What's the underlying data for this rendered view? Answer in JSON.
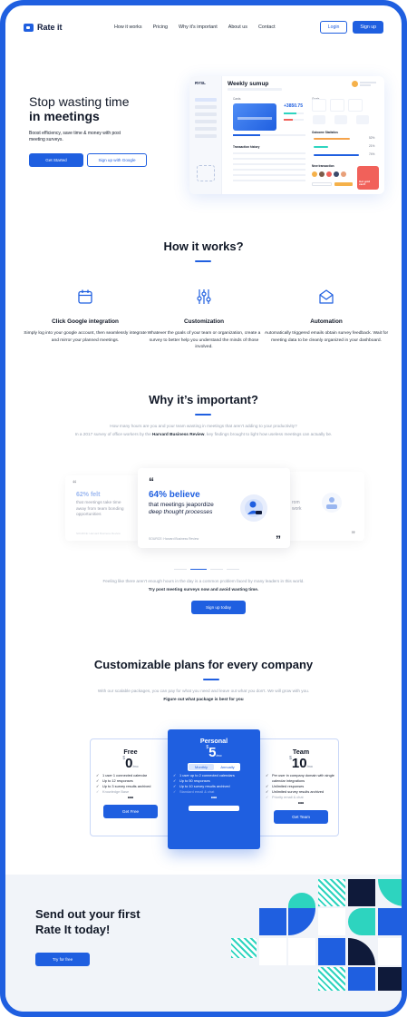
{
  "nav": {
    "logo": "Rate it",
    "links": [
      "How it works",
      "Pricing",
      "Why it's important",
      "About us",
      "Contact"
    ],
    "login": "Login",
    "signup": "Sign up"
  },
  "hero": {
    "title_line1": "Stop wasting time",
    "title_line2": "in meetings",
    "subtitle": "Boost efficiency, save time & money with post meeting surveys.",
    "primary_cta": "Get Started",
    "secondary_cta": "Sign up with Google",
    "dashboard": {
      "brand": "RYSL",
      "title": "Weekly sumup",
      "cards_label": "Cards",
      "amount": "+3850.75",
      "goals_label": "Goals",
      "history_label": "Transaction history",
      "outcome_label": "Outcome Statistics",
      "new_transaction_label": "New transaction",
      "pct1": "52%",
      "pct2": "21%",
      "pct3": "74%",
      "promo_card": "Get gold card!"
    }
  },
  "how": {
    "title": "How it works?",
    "features": [
      {
        "icon": "calendar-icon",
        "title": "Click Google integration",
        "desc": "Simply log into your google account, then seamlessly integrate and mirror your planned meetings."
      },
      {
        "icon": "sliders-icon",
        "title": "Customization",
        "desc": "Whatever the goals of your team or organization, create a survey to better help you understand the minds of those involved."
      },
      {
        "icon": "envelope-icon",
        "title": "Automation",
        "desc": "Automatically triggered emails obtain survey feedback. Wait for meeting data to be cleanly organized in your dashboard."
      }
    ]
  },
  "why": {
    "title": "Why it’s important?",
    "intro1": "How many hours are you and your team wasting in meetings that aren't adding to your productivity?",
    "intro2_pre": "In a 2017 survey of office workers by the ",
    "intro2_source": "Harvard Business Review",
    "intro2_post": ", key findings brought to light how useless meetings can actually be.",
    "left_card": {
      "pct": "62% felt",
      "text": "that meetings take time away from team bonding opportunities",
      "source": "SOURCE: Harvard Business Review"
    },
    "main_card": {
      "quote_open": "“",
      "pct": "64% believe",
      "line1": "that meetings jeapordize",
      "line2": "deep thought processes",
      "source": "SOURCE: Harvard Business Review",
      "quote_close": "”"
    },
    "right_card": {
      "text_a": "rom",
      "text_b": "work",
      "quote_close": "”"
    },
    "outro1": "Feeling like there aren't enough hours in the day is a common problem faced by many leaders in this world.",
    "outro2": "Try post meeting surveys now and avoid wasting time.",
    "cta": "Sign up today"
  },
  "pricing": {
    "title": "Customizable plans for every company",
    "intro1": "With our scalable packages, you can pay for what you need and leave out what you don't. We will grow with you.",
    "intro2": "Figure out what package is best for you",
    "plans": [
      {
        "name": "Free",
        "currency": "$",
        "price": "0",
        "unit": "/mo",
        "features": [
          "1 user 1 connected calendar",
          "Up to 12 responses",
          "Up to 3 survey results archived"
        ],
        "dim": "Knowledge Base",
        "more": "•••",
        "cta": "Get Free"
      },
      {
        "name": "Personal",
        "currency": "$",
        "price": "5",
        "unit": "/mo",
        "toggle": [
          "Monthly",
          "Annually"
        ],
        "features": [
          "1 user up to 2 connected calendars",
          "Up to 50 responses",
          "Up to 10 survey results archived"
        ],
        "dim": "Standard email & chat",
        "more": "•••"
      },
      {
        "name": "Team",
        "currency": "$",
        "price": "10",
        "unit": "/mo",
        "features": [
          "Per user in company domain with single calendar integrations",
          "Unlimited responses",
          "Unlimited survey results archived"
        ],
        "dim": "Priority email & chat",
        "more": "•••",
        "cta": "Get Team"
      }
    ]
  },
  "bottom": {
    "title_line1": "Send out your first",
    "title_line2": "Rate It today!",
    "cta": "Try for free"
  },
  "colors": {
    "accent": "#1f5fe0",
    "teal": "#2dd4bf",
    "navy": "#0f1a3a"
  }
}
